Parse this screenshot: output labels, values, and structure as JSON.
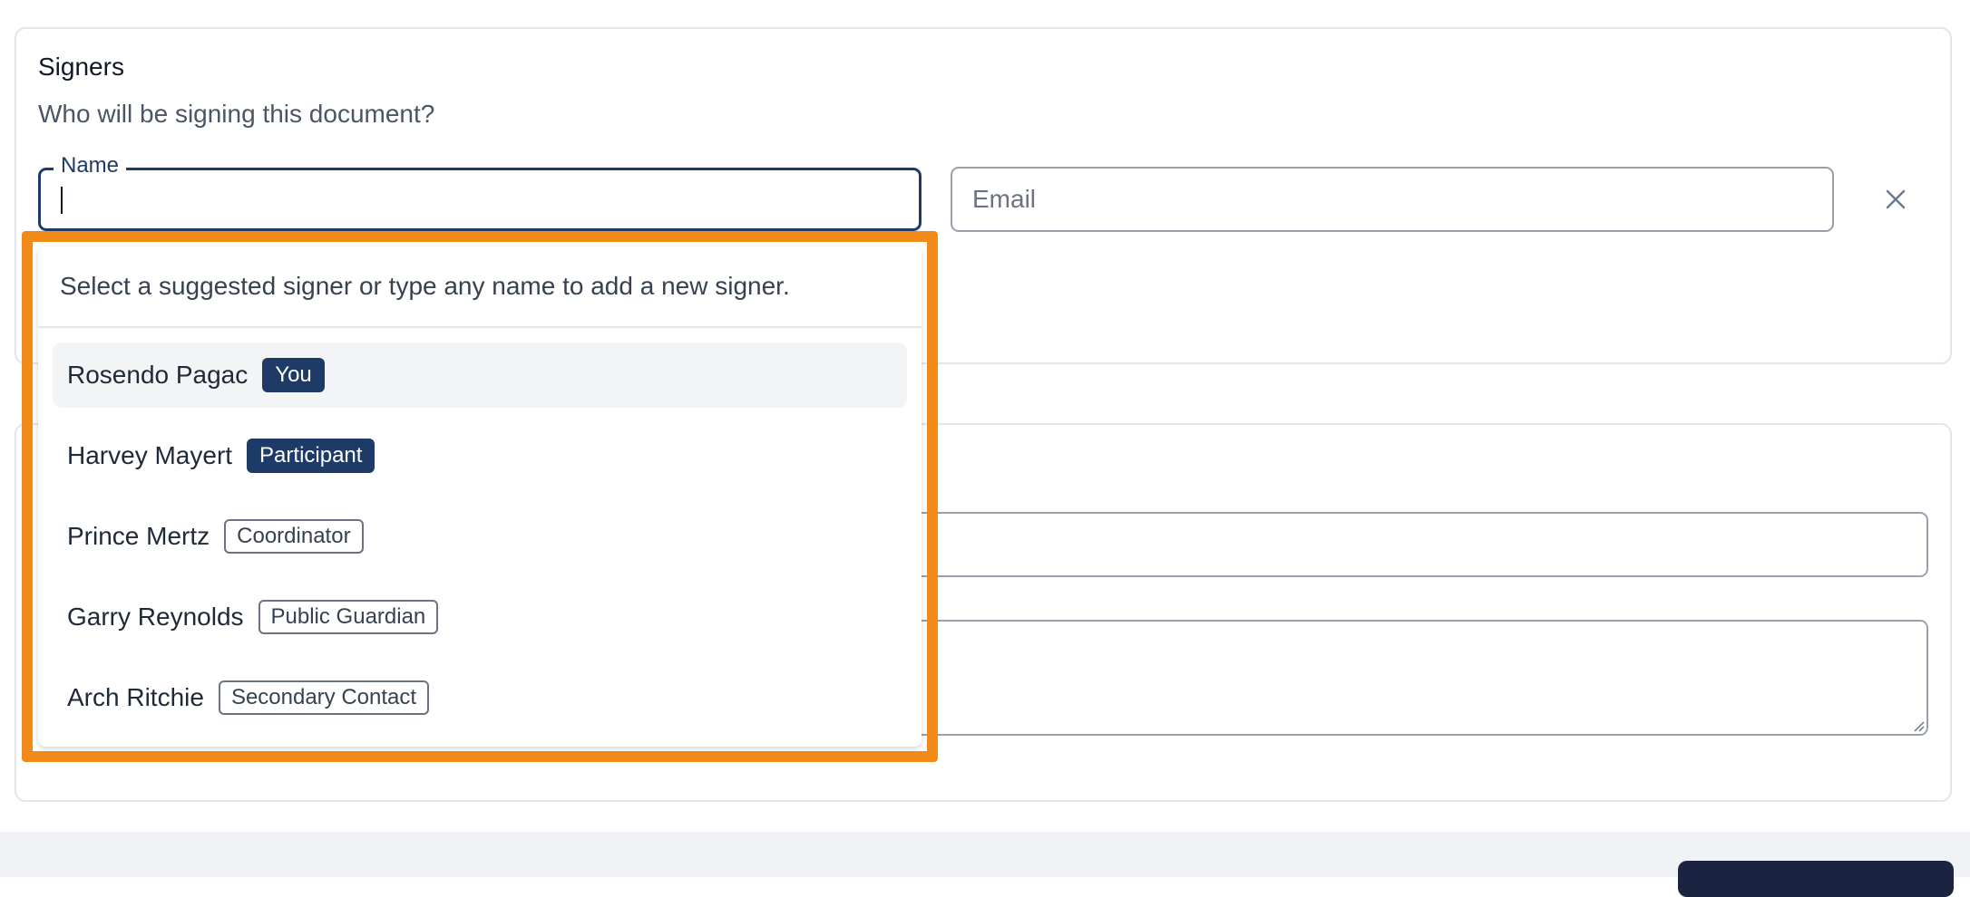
{
  "signers": {
    "title": "Signers",
    "subtitle": "Who will be signing this document?",
    "name_field": {
      "label": "Name",
      "value": ""
    },
    "email_field": {
      "placeholder": "Email",
      "value": ""
    }
  },
  "dropdown": {
    "hint": "Select a suggested signer or type any name to add a new signer.",
    "options": [
      {
        "name": "Rosendo Pagac",
        "role": "You",
        "style": "solid"
      },
      {
        "name": "Harvey Mayert",
        "role": "Participant",
        "style": "solid"
      },
      {
        "name": "Prince Mertz",
        "role": "Coordinator",
        "style": "outline"
      },
      {
        "name": "Garry Reynolds",
        "role": "Public Guardian",
        "style": "outline"
      },
      {
        "name": "Arch Ritchie",
        "role": "Secondary Contact",
        "style": "outline"
      }
    ]
  },
  "colors": {
    "accent": "#1e3a66",
    "highlight": "#f28a1a",
    "primary_button": "#1a2440"
  },
  "icons": {
    "remove": "close-icon",
    "textarea_resize": "resize-handle-icon"
  }
}
